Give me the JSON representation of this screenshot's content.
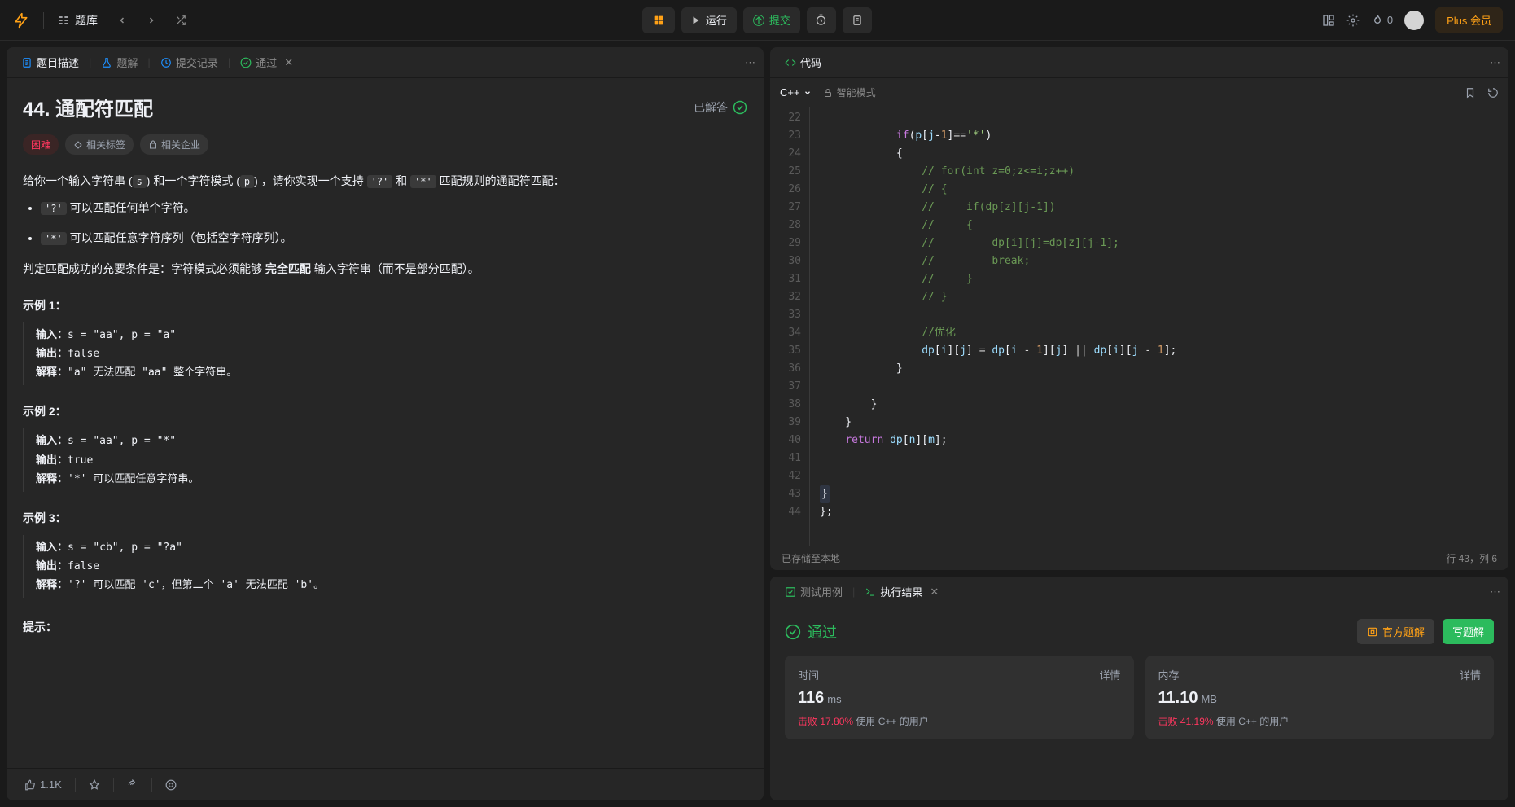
{
  "topbar": {
    "problems_link": "题库",
    "run": "运行",
    "submit": "提交",
    "streak": "0",
    "plus": "Plus 会员"
  },
  "left": {
    "tabs": {
      "description": "题目描述",
      "solution": "题解",
      "submissions": "提交记录",
      "accepted": "通过"
    },
    "title": "44. 通配符匹配",
    "solved": "已解答",
    "difficulty": "困难",
    "tag_topics": "相关标签",
    "tag_companies": "相关企业",
    "intro_1a": "给你一个输入字符串 (",
    "intro_s": "s",
    "intro_1b": ") 和一个字符模式 (",
    "intro_p": "p",
    "intro_1c": ") ，请你实现一个支持 ",
    "intro_q": "'?'",
    "intro_and": " 和 ",
    "intro_star": "'*'",
    "intro_1d": " 匹配规则的通配符匹配：",
    "bullet_q_code": "'?'",
    "bullet_q": " 可以匹配任何单个字符。",
    "bullet_s_code": "'*'",
    "bullet_s": " 可以匹配任意字符序列（包括空字符序列）。",
    "judge_a": "判定匹配成功的充要条件是：字符模式必须能够 ",
    "judge_bold": "完全匹配",
    "judge_b": " 输入字符串（而不是部分匹配）。",
    "ex1_title": "示例 1：",
    "ex1_in_lbl": "输入：",
    "ex1_in": "s = \"aa\", p = \"a\"",
    "ex1_out_lbl": "输出：",
    "ex1_out": "false",
    "ex1_exp_lbl": "解释：",
    "ex1_exp": "\"a\" 无法匹配 \"aa\" 整个字符串。",
    "ex2_title": "示例 2：",
    "ex2_in": "s = \"aa\", p = \"*\"",
    "ex2_out": "true",
    "ex2_exp": "'*' 可以匹配任意字符串。",
    "ex3_title": "示例 3：",
    "ex3_in": "s = \"cb\", p = \"?a\"",
    "ex3_out": "false",
    "ex3_exp": "'?' 可以匹配 'c'，但第二个 'a' 无法匹配 'b'。",
    "hint_title": "提示：",
    "likes": "1.1K"
  },
  "code": {
    "panel_title": "代码",
    "language": "C++",
    "smart_mode": "智能模式",
    "lines": [
      {
        "n": 22,
        "html": ""
      },
      {
        "n": 23,
        "html": "            <span class='kw'>if</span>(<span class='id'>p</span>[<span class='id'>j</span>-<span class='num'>1</span>]<span class='op'>==</span><span class='str'>'*'</span>)"
      },
      {
        "n": 24,
        "html": "            {"
      },
      {
        "n": 25,
        "html": "                <span class='cm'>// for(int z=0;z<=i;z++)</span>"
      },
      {
        "n": 26,
        "html": "                <span class='cm'>// {</span>"
      },
      {
        "n": 27,
        "html": "                <span class='cm'>//     if(dp[z][j-1])</span>"
      },
      {
        "n": 28,
        "html": "                <span class='cm'>//     {</span>"
      },
      {
        "n": 29,
        "html": "                <span class='cm'>//         dp[i][j]=dp[z][j-1];</span>"
      },
      {
        "n": 30,
        "html": "                <span class='cm'>//         break;</span>"
      },
      {
        "n": 31,
        "html": "                <span class='cm'>//     }</span>"
      },
      {
        "n": 32,
        "html": "                <span class='cm'>// }</span>"
      },
      {
        "n": 33,
        "html": ""
      },
      {
        "n": 34,
        "html": "                <span class='cm'>//优化</span>"
      },
      {
        "n": 35,
        "html": "                <span class='id'>dp</span>[<span class='id'>i</span>][<span class='id'>j</span>] <span class='op'>=</span> <span class='id'>dp</span>[<span class='id'>i</span> <span class='op'>-</span> <span class='num'>1</span>][<span class='id'>j</span>] <span class='op'>||</span> <span class='id'>dp</span>[<span class='id'>i</span>][<span class='id'>j</span> <span class='op'>-</span> <span class='num'>1</span>];"
      },
      {
        "n": 36,
        "html": "            }"
      },
      {
        "n": 37,
        "html": ""
      },
      {
        "n": 38,
        "html": "        }"
      },
      {
        "n": 39,
        "html": "    }"
      },
      {
        "n": 40,
        "html": "    <span class='kw'>return</span> <span class='id'>dp</span>[<span class='id'>n</span>][<span class='id'>m</span>];"
      },
      {
        "n": 41,
        "html": ""
      },
      {
        "n": 42,
        "html": ""
      },
      {
        "n": 43,
        "html": "<span class='hl'>}</span>"
      },
      {
        "n": 44,
        "html": "};"
      }
    ],
    "saved": "已存储至本地",
    "cursor": "行 43，列 6"
  },
  "results": {
    "tab_testcase": "测试用例",
    "tab_result": "执行结果",
    "status": "通过",
    "official_sol": "官方题解",
    "write_sol": "写题解",
    "time_label": "时间",
    "time_val": "116",
    "time_unit": "ms",
    "time_detail": "详情",
    "time_beats_a": "击败 ",
    "time_beats_pct": "17.80%",
    "time_beats_b": " 使用 C++ 的用户",
    "mem_label": "内存",
    "mem_val": "11.10",
    "mem_unit": "MB",
    "mem_beats_pct": "41.19%"
  }
}
